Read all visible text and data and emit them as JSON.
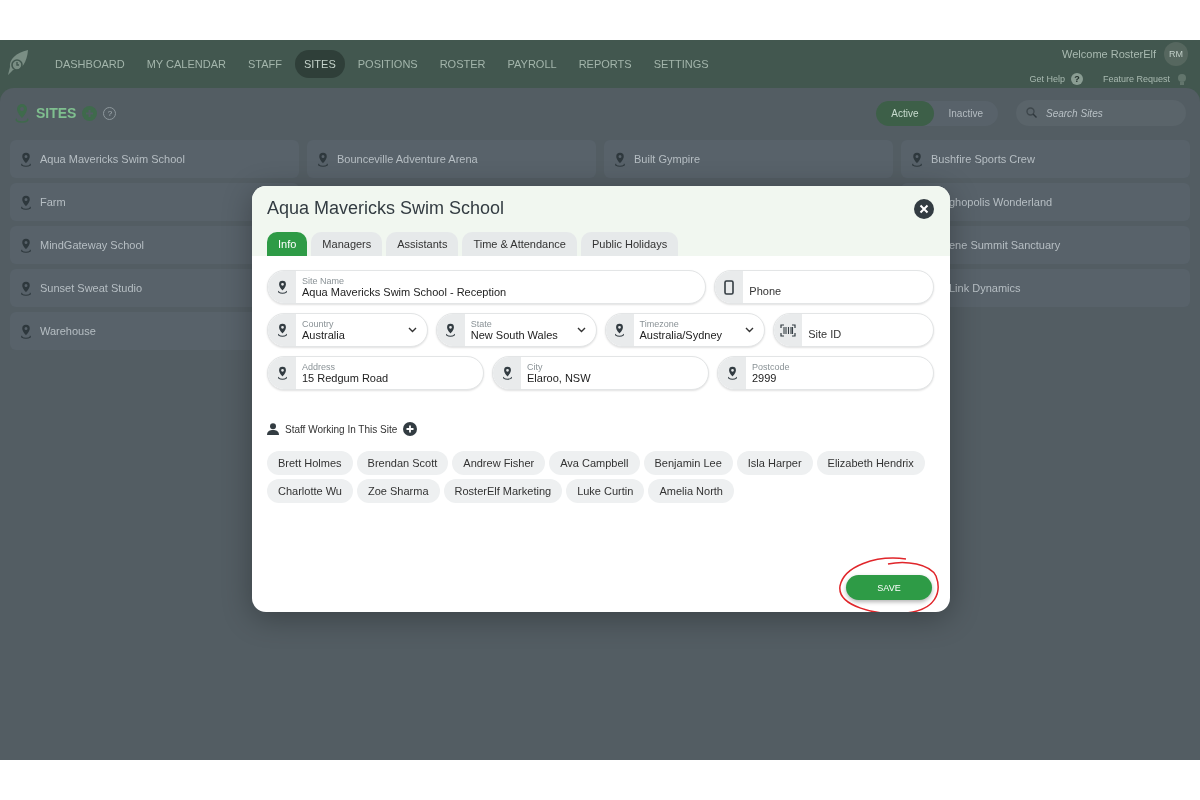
{
  "nav": {
    "items": [
      {
        "label": "DASHBOARD",
        "selected": false
      },
      {
        "label": "MY CALENDAR",
        "selected": false
      },
      {
        "label": "STAFF",
        "selected": false
      },
      {
        "label": "SITES",
        "selected": true
      },
      {
        "label": "POSITIONS",
        "selected": false
      },
      {
        "label": "ROSTER",
        "selected": false
      },
      {
        "label": "PAYROLL",
        "selected": false
      },
      {
        "label": "REPORTS",
        "selected": false
      },
      {
        "label": "SETTINGS",
        "selected": false
      }
    ],
    "welcome": "Welcome RosterElf",
    "avatar": "RM",
    "help": "Get Help",
    "help_mark": "?",
    "feature": "Feature Request"
  },
  "page": {
    "title": "SITES",
    "help_mark": "?",
    "filters": [
      {
        "label": "Active",
        "selected": true
      },
      {
        "label": "Inactive",
        "selected": false
      }
    ],
    "search": {
      "placeholder": "Search Sites"
    }
  },
  "sites": [
    {
      "name": "Aqua Mavericks Swim School",
      "partly_hidden": false
    },
    {
      "name": "Bounceville Adventure Arena",
      "partly_hidden": false
    },
    {
      "name": "Built Gympire",
      "partly_hidden": false
    },
    {
      "name": "Bushfire Sports Crew",
      "partly_hidden": false
    },
    {
      "name": "Farm",
      "partly_hidden": false
    },
    {
      "name": "ghopolis Wonderland",
      "partly_hidden": true
    },
    {
      "name": "MindGateway School",
      "partly_hidden": false
    },
    {
      "name": "ene Summit Sanctuary",
      "partly_hidden": true
    },
    {
      "name": "Sunset Sweat Studio",
      "partly_hidden": false
    },
    {
      "name": "Link Dynamics",
      "partly_hidden": true
    },
    {
      "name": "Warehouse",
      "partly_hidden": false
    }
  ],
  "modal": {
    "title": "Aqua Mavericks Swim School",
    "tabs": [
      {
        "label": "Info",
        "selected": true
      },
      {
        "label": "Managers",
        "selected": false
      },
      {
        "label": "Assistants",
        "selected": false
      },
      {
        "label": "Time & Attendance",
        "selected": false
      },
      {
        "label": "Public Holidays",
        "selected": false
      }
    ],
    "field_rows": [
      [
        {
          "kind": "text",
          "label": "Site Name",
          "value": "Aqua Mavericks Swim School - Reception"
        },
        {
          "kind": "phone",
          "placeholder": "Phone"
        }
      ],
      [
        {
          "kind": "select",
          "label": "Country",
          "value": "Australia"
        },
        {
          "kind": "select",
          "label": "State",
          "value": "New South Wales"
        },
        {
          "kind": "select",
          "label": "Timezone",
          "value": "Australia/Sydney"
        },
        {
          "kind": "code",
          "placeholder": "Site ID"
        }
      ],
      [
        {
          "kind": "text",
          "label": "Address",
          "value": "15 Redgum Road"
        },
        {
          "kind": "text",
          "label": "City",
          "value": "Elaroo, NSW"
        },
        {
          "kind": "text",
          "label": "Postcode",
          "value": "2999"
        }
      ]
    ],
    "staff_heading": "Staff Working In This Site",
    "staff": [
      "Brett Holmes",
      "Brendan Scott",
      "Andrew Fisher",
      "Ava Campbell",
      "Benjamin Lee",
      "Isla Harper",
      "Elizabeth Hendrix",
      "Charlotte Wu",
      "Zoe Sharma",
      "RosterElf Marketing",
      "Luke Curtin",
      "Amelia North"
    ],
    "save": "SAVE"
  }
}
